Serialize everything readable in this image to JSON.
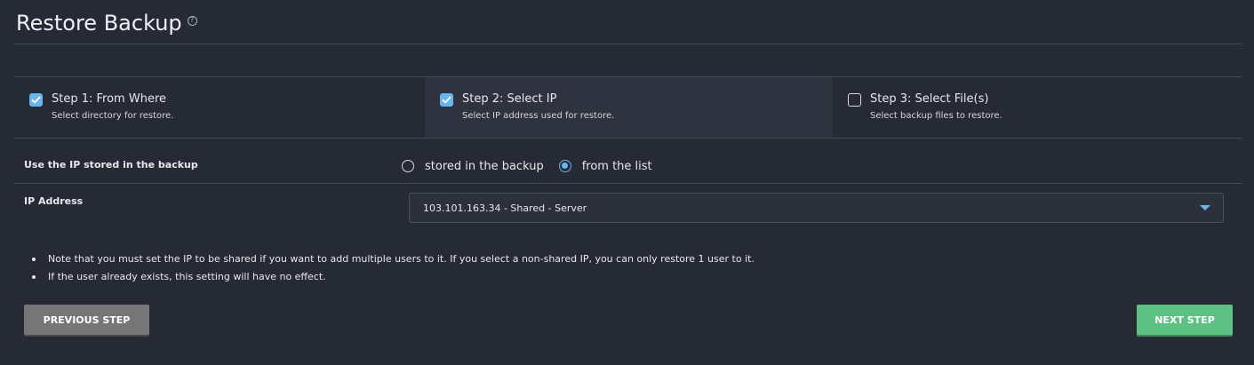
{
  "header": {
    "title": "Restore Backup",
    "help_icon": "?"
  },
  "steps": [
    {
      "title": "Step 1: From Where",
      "subtitle": "Select directory for restore.",
      "checked": true,
      "icon": "checkbox-checked-icon"
    },
    {
      "title": "Step 2: Select IP",
      "subtitle": "Select IP address used for restore.",
      "checked": true,
      "active": true,
      "icon": "checkbox-checked-icon"
    },
    {
      "title": "Step 3: Select File(s)",
      "subtitle": "Select backup files to restore.",
      "checked": false,
      "icon": "checkbox-unchecked-icon"
    }
  ],
  "ip_source": {
    "label": "Use the IP stored in the backup",
    "options": [
      {
        "label": "stored in the backup",
        "selected": false
      },
      {
        "label": "from the list",
        "selected": true
      }
    ]
  },
  "ip_address": {
    "label": "IP Address",
    "value": "103.101.163.34 - Shared - Server"
  },
  "notes": [
    "Note that you must set the IP to be shared if you want to add multiple users to it. If you select a non-shared IP, you can only restore 1 user to it.",
    "If the user already exists, this setting will have no effect."
  ],
  "buttons": {
    "previous": "PREVIOUS STEP",
    "next": "NEXT STEP"
  },
  "colors": {
    "background": "#262a35",
    "accent": "#6ab4f0",
    "next_button": "#5cc183",
    "previous_button": "#767676"
  }
}
